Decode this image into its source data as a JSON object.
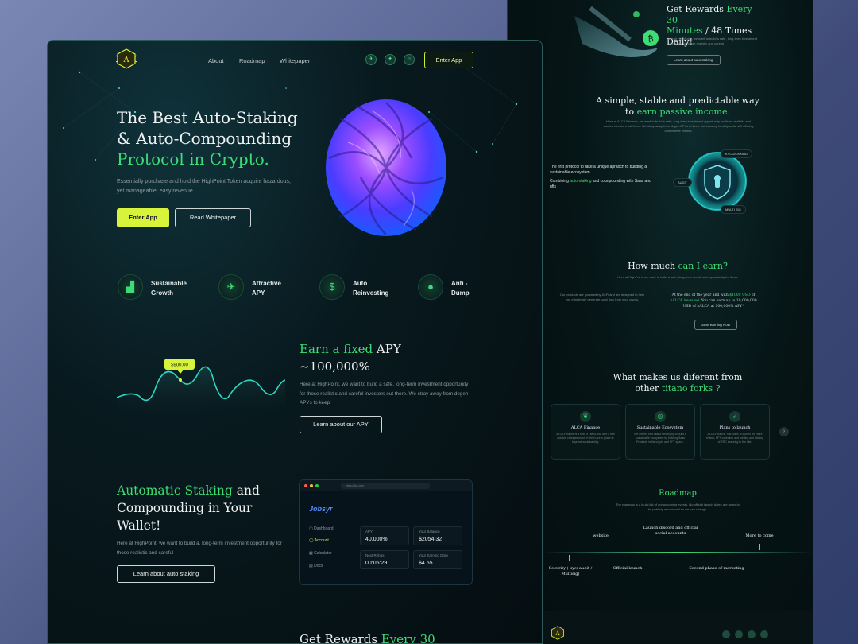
{
  "main": {
    "nav": {
      "links": [
        "About",
        "Roadmap",
        "Whitepaper"
      ],
      "enter_app": "Enter App",
      "logo_letter": "A"
    },
    "hero": {
      "title_line1": "The Best Auto-Staking",
      "title_line2": "& Auto-Compounding",
      "title_line3": "Protocol in Crypto.",
      "description": "Essentially purchase and hold the HighPoint Token acquire hazardous, yet manageable, easy revenue",
      "enter_app": "Enter App",
      "read_whitepaper": "Read Whitepaper"
    },
    "features": [
      {
        "line1": "Sustainable",
        "line2": "Growth",
        "icon": "growth-chart-icon"
      },
      {
        "line1": "Attractive",
        "line2": "APY",
        "icon": "runner-icon"
      },
      {
        "line1": "Auto",
        "line2": "Reinvesting",
        "icon": "dollar-cycle-icon"
      },
      {
        "line1": "Anti -",
        "line2": "Dump",
        "icon": "coin-icon"
      }
    ],
    "apy": {
      "price_tag": "$900.00",
      "title_green": "Earn a fixed",
      "title_rest": " APY",
      "title_line2": "~100,000%",
      "description": "Here at HighPoint, we want to build a safe, long-term investment opportunity for those realistic and careful investors out there. We stray away from degen APYs to keep",
      "button": "Learn about our APY"
    },
    "staking": {
      "title_green": "Automatic Staking",
      "title_rest": " and",
      "title_line2": "Compounding in Your",
      "title_line3": "Wallet!",
      "description": "Here at HighPoint, we want to build a, long-term investment opportunity for those realistic and careful",
      "button": "Learn about auto staking"
    },
    "dashboard": {
      "url": "https://fsd.com",
      "brand": "Jobsyr",
      "menu": [
        "Dashboard",
        "Account",
        "Calculator",
        "Docs"
      ],
      "active_menu": "Account",
      "tiles": [
        {
          "label": "APY",
          "value": "40,000%"
        },
        {
          "label": "Your Balance",
          "value": "$2054.32"
        },
        {
          "label": "Next Rebas",
          "value": "00:05:29"
        },
        {
          "label": "Your Earning Daily",
          "value": "$4.55"
        }
      ]
    },
    "bottom": {
      "title": "Get Rewards ",
      "title_green": "Every 30"
    }
  },
  "side": {
    "rewards": {
      "title_prefix": "Get Rewards ",
      "title_green1": "Every 30",
      "title_green2": "Minutes",
      "title_rest": " / 48 Times",
      "title_line3": "Daily!",
      "description": "Here at HighPoint, we want to build a safe, long-term investment opportunity for those realistic and careful",
      "button": "Learn about auto staking"
    },
    "passive": {
      "title_line1": "A simple, stable and predictable way",
      "title_prefix": "to ",
      "title_green": "earn passive income.",
      "description": "Here at ALCA Finance, we want to build a safe, long-term investment opportunity for those realistic and careful investors out there. We stray away from degen APYs to keep our treasury healthy while still offering competitive returns."
    },
    "protocol": {
      "line1": "The first protocol to take a unique apraoch to building a sustainable ecosystem.",
      "line2_prefix": "Combining ",
      "line2_green": "auto-staking",
      "line2_rest": " and counpounding with Saas and nfts .",
      "chips": [
        "KYC-DOXXING",
        "AUDIT",
        "MULTI SIG"
      ]
    },
    "earn": {
      "title": "How much ",
      "title_green": "can I earn?",
      "subtitle": "Here at HighPoint, we want to build a safe, long-term investment opportunity for those",
      "left": "Our products are powered by DeFi and are designed to help you effortlessly generate cash flow from your crypto.",
      "right_prefix": "At the end of the year and with ",
      "right_green1": "$1000 USD",
      "right_mid": " of ",
      "right_green2": "$ALCA invested",
      "right_rest": ". You can earn up to 10,000,000 USD of $ALCA at 100,000% APY*",
      "button": "Start earning Now"
    },
    "different": {
      "title_line1": "What makes us diferent from",
      "title_prefix": "other ",
      "title_green": "titano forks ?",
      "cards": [
        {
          "title": "ALCA Finance",
          "text": "ALCA Finance is a fork of Titano, but with a few notable changes most of which are in place to improve sustainability.",
          "icon": "leaf-icon"
        },
        {
          "title": "Sustainable Ecosystem",
          "text": "We are the first Titano fork trying to build a sustainable ecosystem by building Saas Products in the crypto and NFT space.",
          "icon": "globe-icon"
        },
        {
          "title": "Plans to launch",
          "text": "ALCA Finance. has plans to launch an entire chains, NFT collection and minting and staking of ERC ensuring to the site.",
          "icon": "rocket-icon"
        }
      ],
      "next": "›"
    },
    "roadmap": {
      "title": "Roadmap",
      "subtitle": "The roadmap is a to-do list of our upcoming events. No official launch dates are going to be publicly announced so we can change.",
      "top": [
        "website",
        "Launch discord and official social accounts",
        "More to come"
      ],
      "bottom": [
        "Security ( kyc/ audit / Multisig)",
        "Official launch",
        "Second phase of marketing"
      ]
    },
    "footer": {
      "logo_letter": "A"
    }
  }
}
